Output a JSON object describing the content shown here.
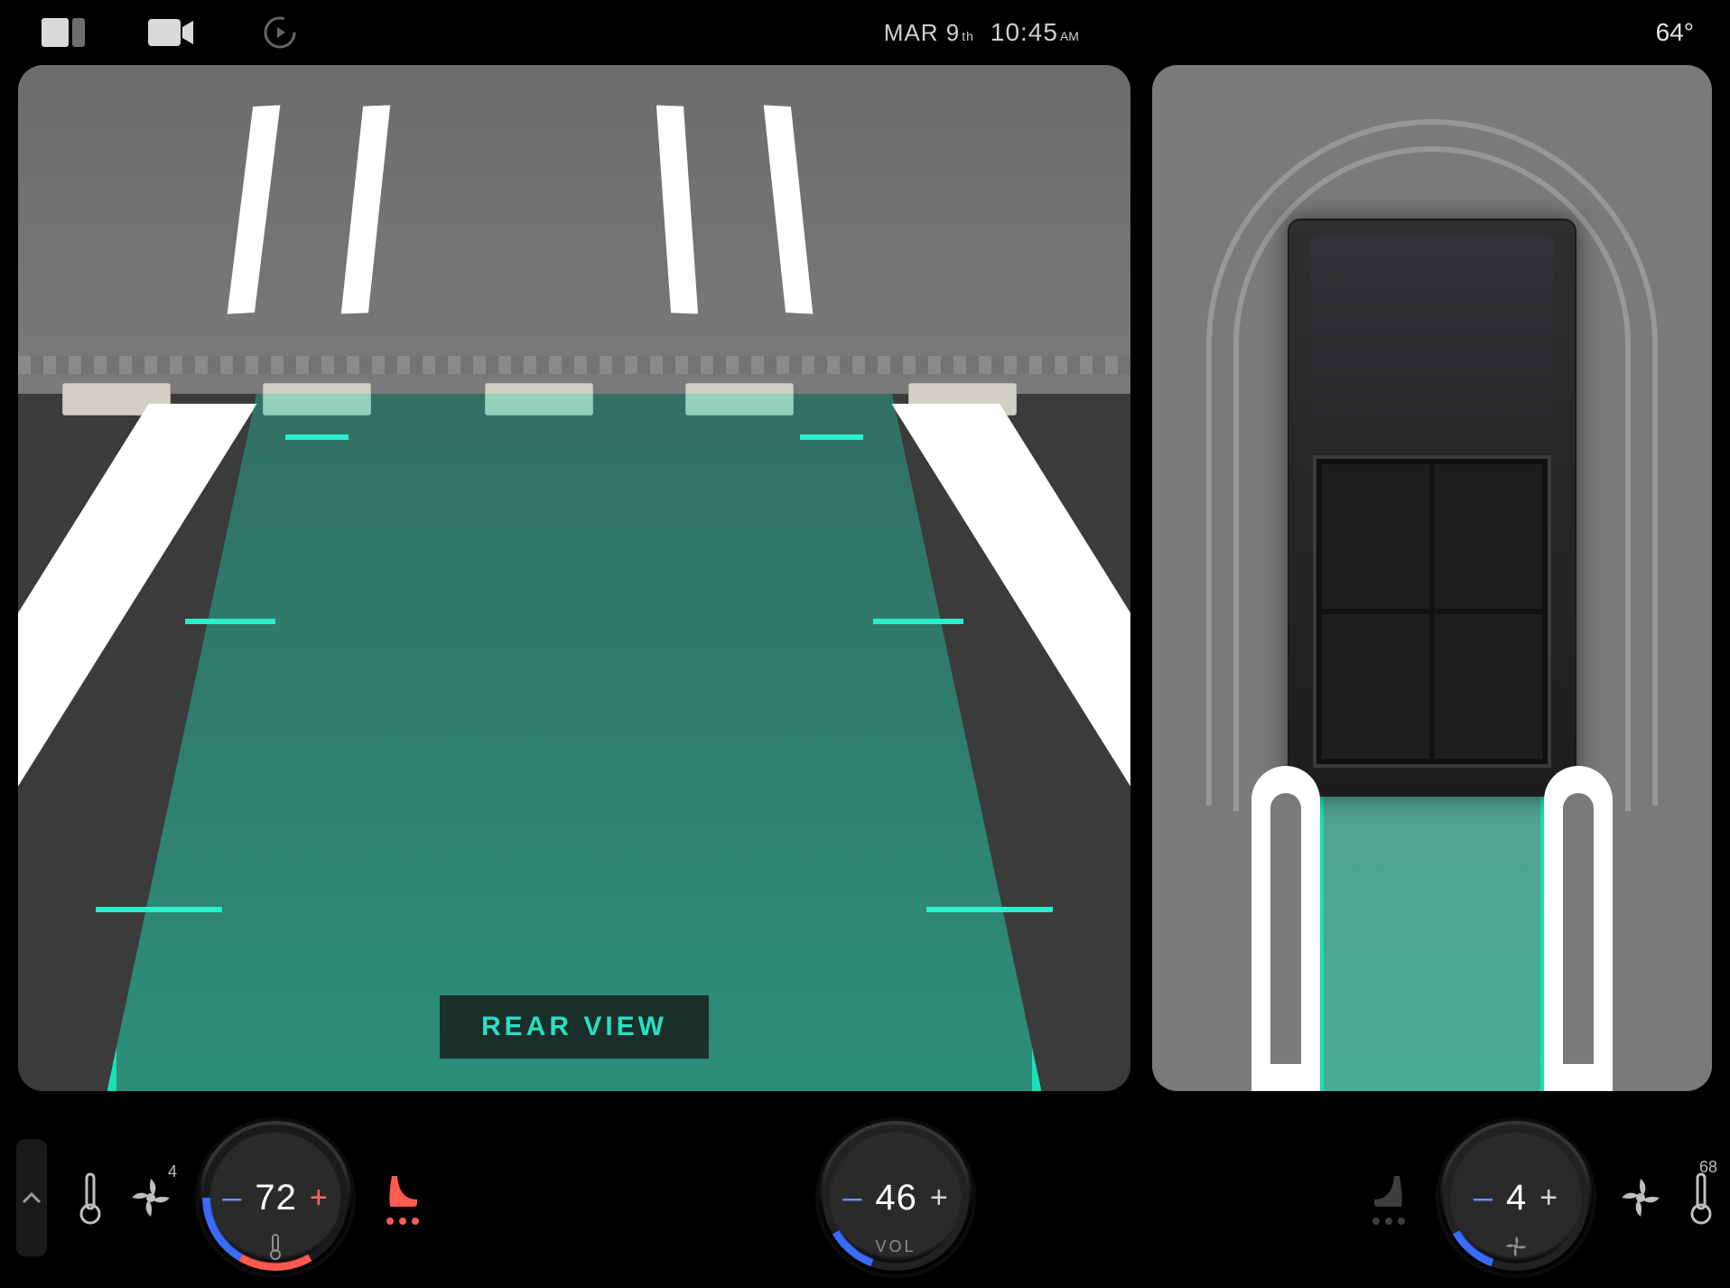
{
  "topbar": {
    "date_month": "MAR",
    "date_day": "9",
    "date_suffix": "th",
    "time": "10:45",
    "time_suffix": "AM",
    "outside_temp": "64°"
  },
  "camera": {
    "view_label": "REAR VIEW"
  },
  "climate": {
    "left_temp": "72",
    "left_fan_level": "4",
    "right_temp_or_fan": "4",
    "right_aux": "68",
    "volume": "46",
    "volume_label": "VOL"
  }
}
